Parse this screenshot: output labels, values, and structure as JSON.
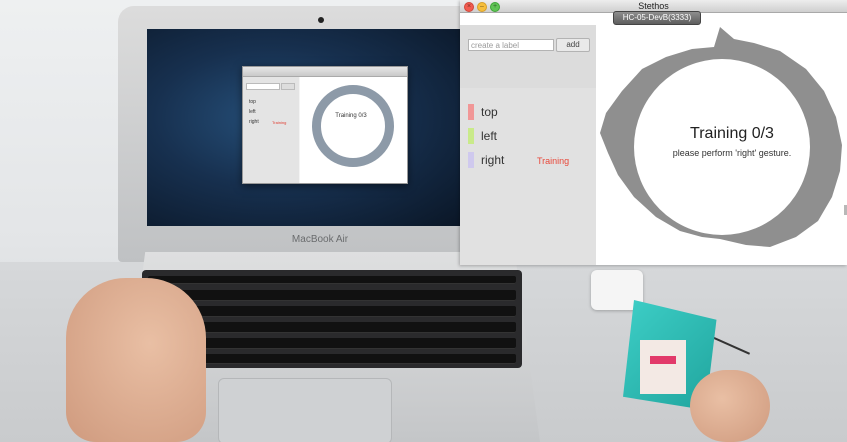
{
  "laptop": {
    "brand_label": "MacBook Air",
    "mini_app": {
      "labels": [
        "top",
        "left",
        "right"
      ],
      "status": "Training",
      "message": "Training 0/3"
    }
  },
  "window": {
    "title": "Stethos",
    "device_badge": "HC-05-DevB(3333)",
    "traffic_lights": {
      "close_color": "#f25c4f",
      "minimize_color": "#f6be3b",
      "maximize_color": "#5fc454"
    }
  },
  "sidebar": {
    "label_input": {
      "placeholder": "create a label",
      "value": ""
    },
    "add_button_label": "add",
    "labels": [
      {
        "name": "top",
        "color": "#f19797",
        "status": ""
      },
      {
        "name": "left",
        "color": "#c9ea8a",
        "status": ""
      },
      {
        "name": "right",
        "color": "#cfc9ee",
        "status": "Training"
      }
    ]
  },
  "canvas": {
    "title": "Training 0/3",
    "instruction": "please perform 'right' gesture.",
    "waveform_color": "#8f8f8f"
  }
}
